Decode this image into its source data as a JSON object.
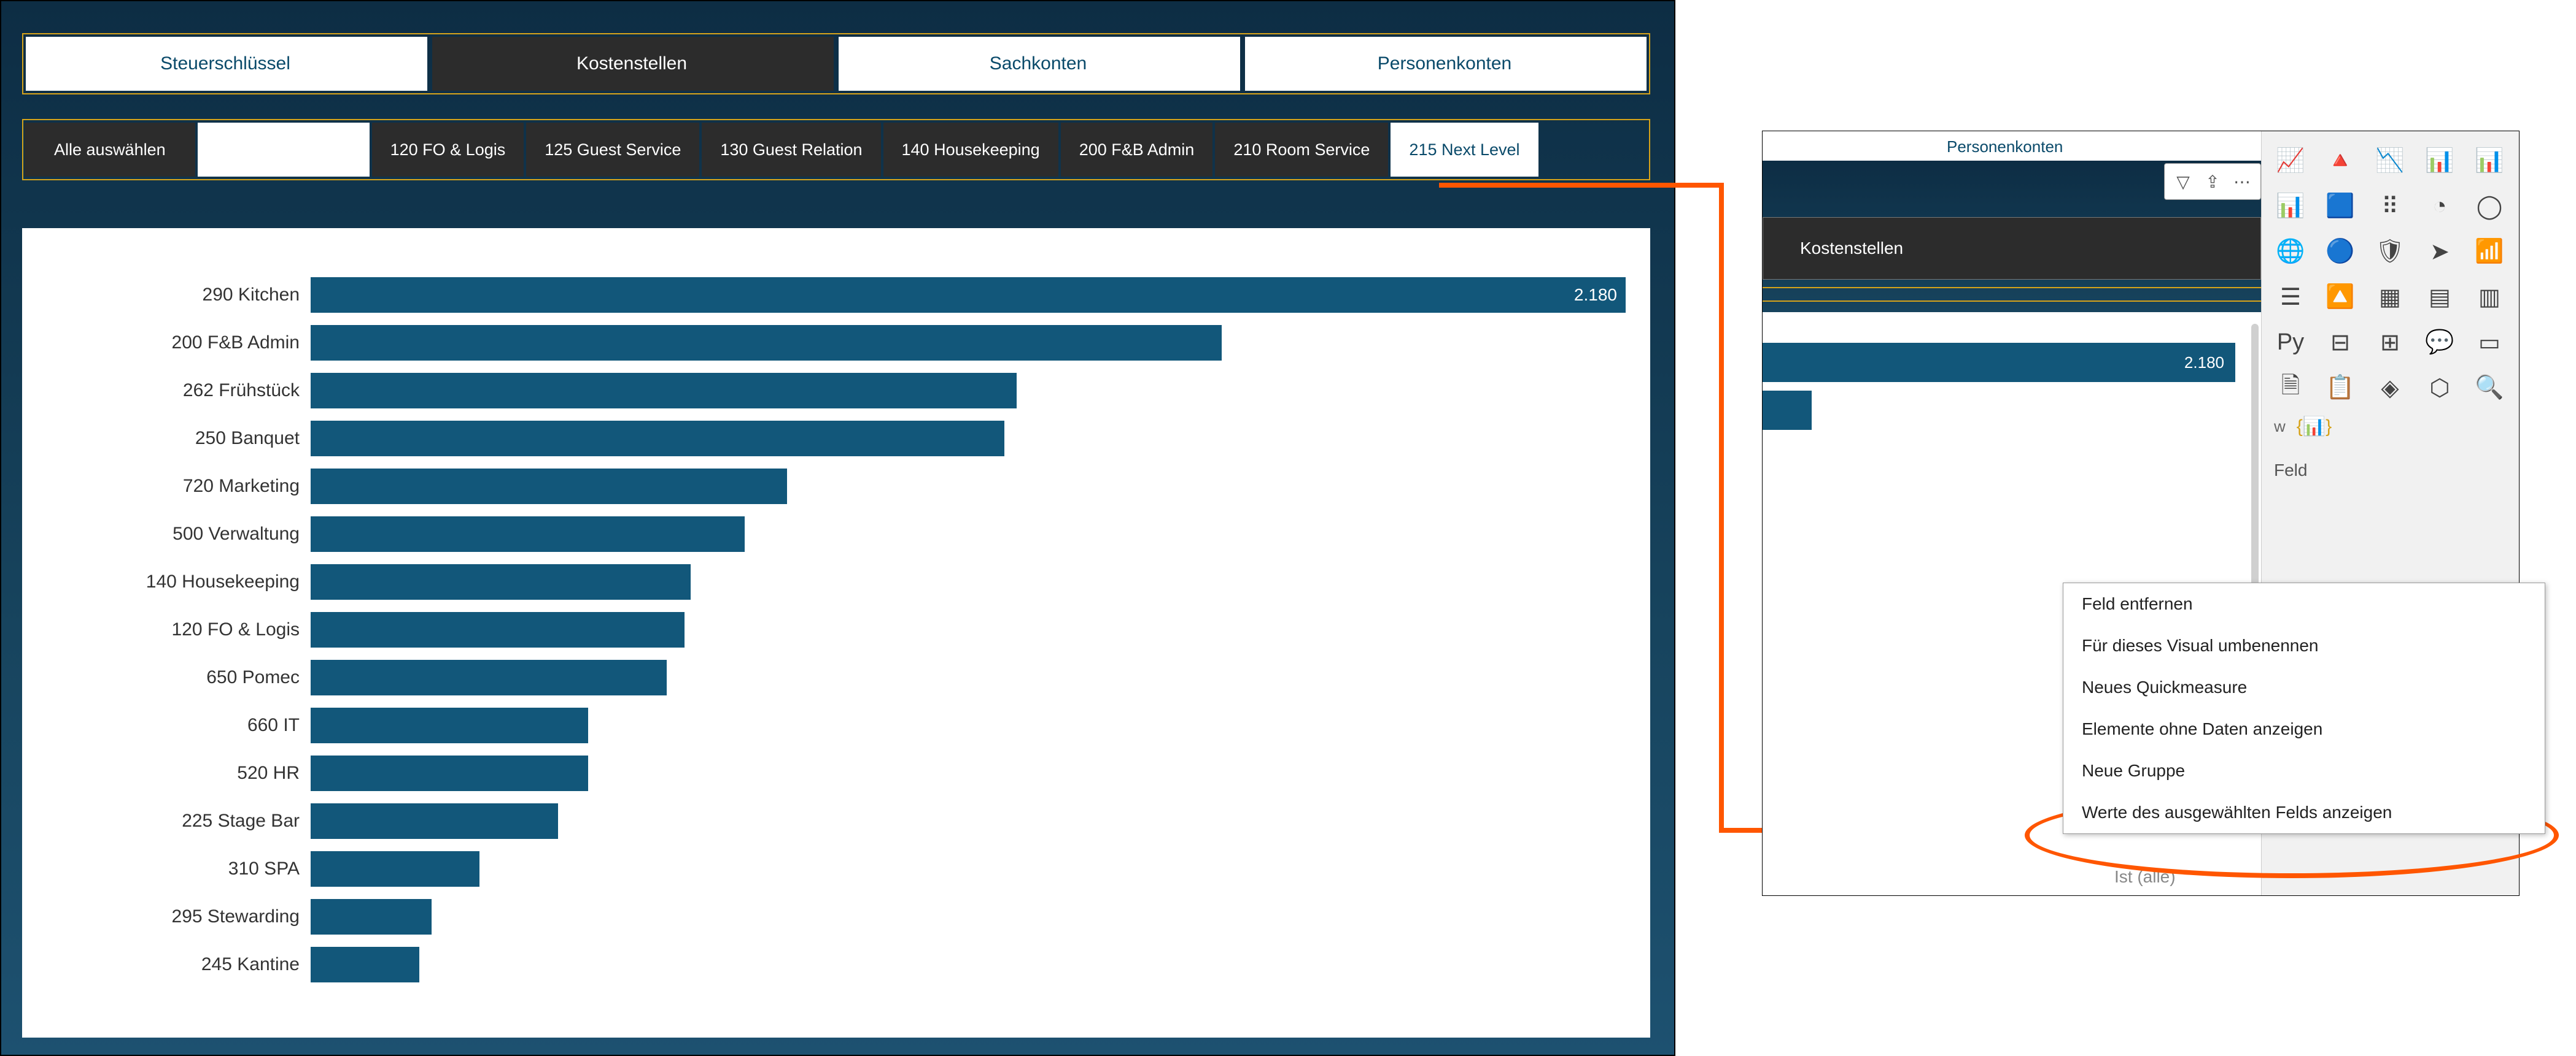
{
  "topnav": {
    "tabs": [
      "Steuerschlüssel",
      "Kostenstellen",
      "Sachkonten",
      "Personenkonten"
    ],
    "active_index": 1
  },
  "filterbar": {
    "select_all": "Alle auswählen",
    "items": [
      "120 FO & Logis",
      "125 Guest Service",
      "130 Guest Relation",
      "140 Housekeeping",
      "200 F&B Admin",
      "210 Room Service",
      "215 Next Level"
    ],
    "active_index": 6
  },
  "chart_data": {
    "type": "bar",
    "orientation": "horizontal",
    "value_label_on_first_bar": "2.180",
    "categories": [
      "290 Kitchen",
      "200 F&B Admin",
      "262 Frühstück",
      "250 Banquet",
      "720 Marketing",
      "500 Verwaltung",
      "140 Housekeeping",
      "120 FO & Logis",
      "650 Pomec",
      "660 IT",
      "520 HR",
      "225 Stage Bar",
      "310 SPA",
      "295 Stewarding",
      "245 Kantine"
    ],
    "values": [
      2180,
      1510,
      1170,
      1150,
      790,
      720,
      630,
      620,
      590,
      460,
      460,
      410,
      280,
      200,
      180
    ],
    "xlim": [
      0,
      2180
    ]
  },
  "panel": {
    "mini_tab": "Personenkonten",
    "kostenstellen_label": "Kostenstellen",
    "mini_bar_value": "2.180",
    "feld_label": "Feld",
    "trailing_text": "Ist (alle)"
  },
  "ctxmenu": {
    "items": [
      "Feld entfernen",
      "Für dieses Visual umbenennen",
      "Neues Quickmeasure",
      "Elemente ohne Daten anzeigen",
      "Neue Gruppe",
      "Werte des ausgewählten Felds anzeigen"
    ]
  },
  "icons": {
    "filter": "▽",
    "export": "⇪",
    "more": "⋯",
    "viz": [
      "📈",
      "🔺",
      "📉",
      "📊",
      "📊",
      "📊",
      "🟦",
      "⠿",
      "◔",
      "◯",
      "🌐",
      "🔵",
      "🛡",
      "➤",
      "📶",
      "☰",
      "🔼",
      "▦",
      "▤",
      "▥",
      "Py",
      "⊟",
      "⊞",
      "💬",
      "▭",
      "🗎",
      "📋",
      "◈",
      "⬡",
      "🔍"
    ],
    "w": "w",
    "brace": "{📊}"
  }
}
